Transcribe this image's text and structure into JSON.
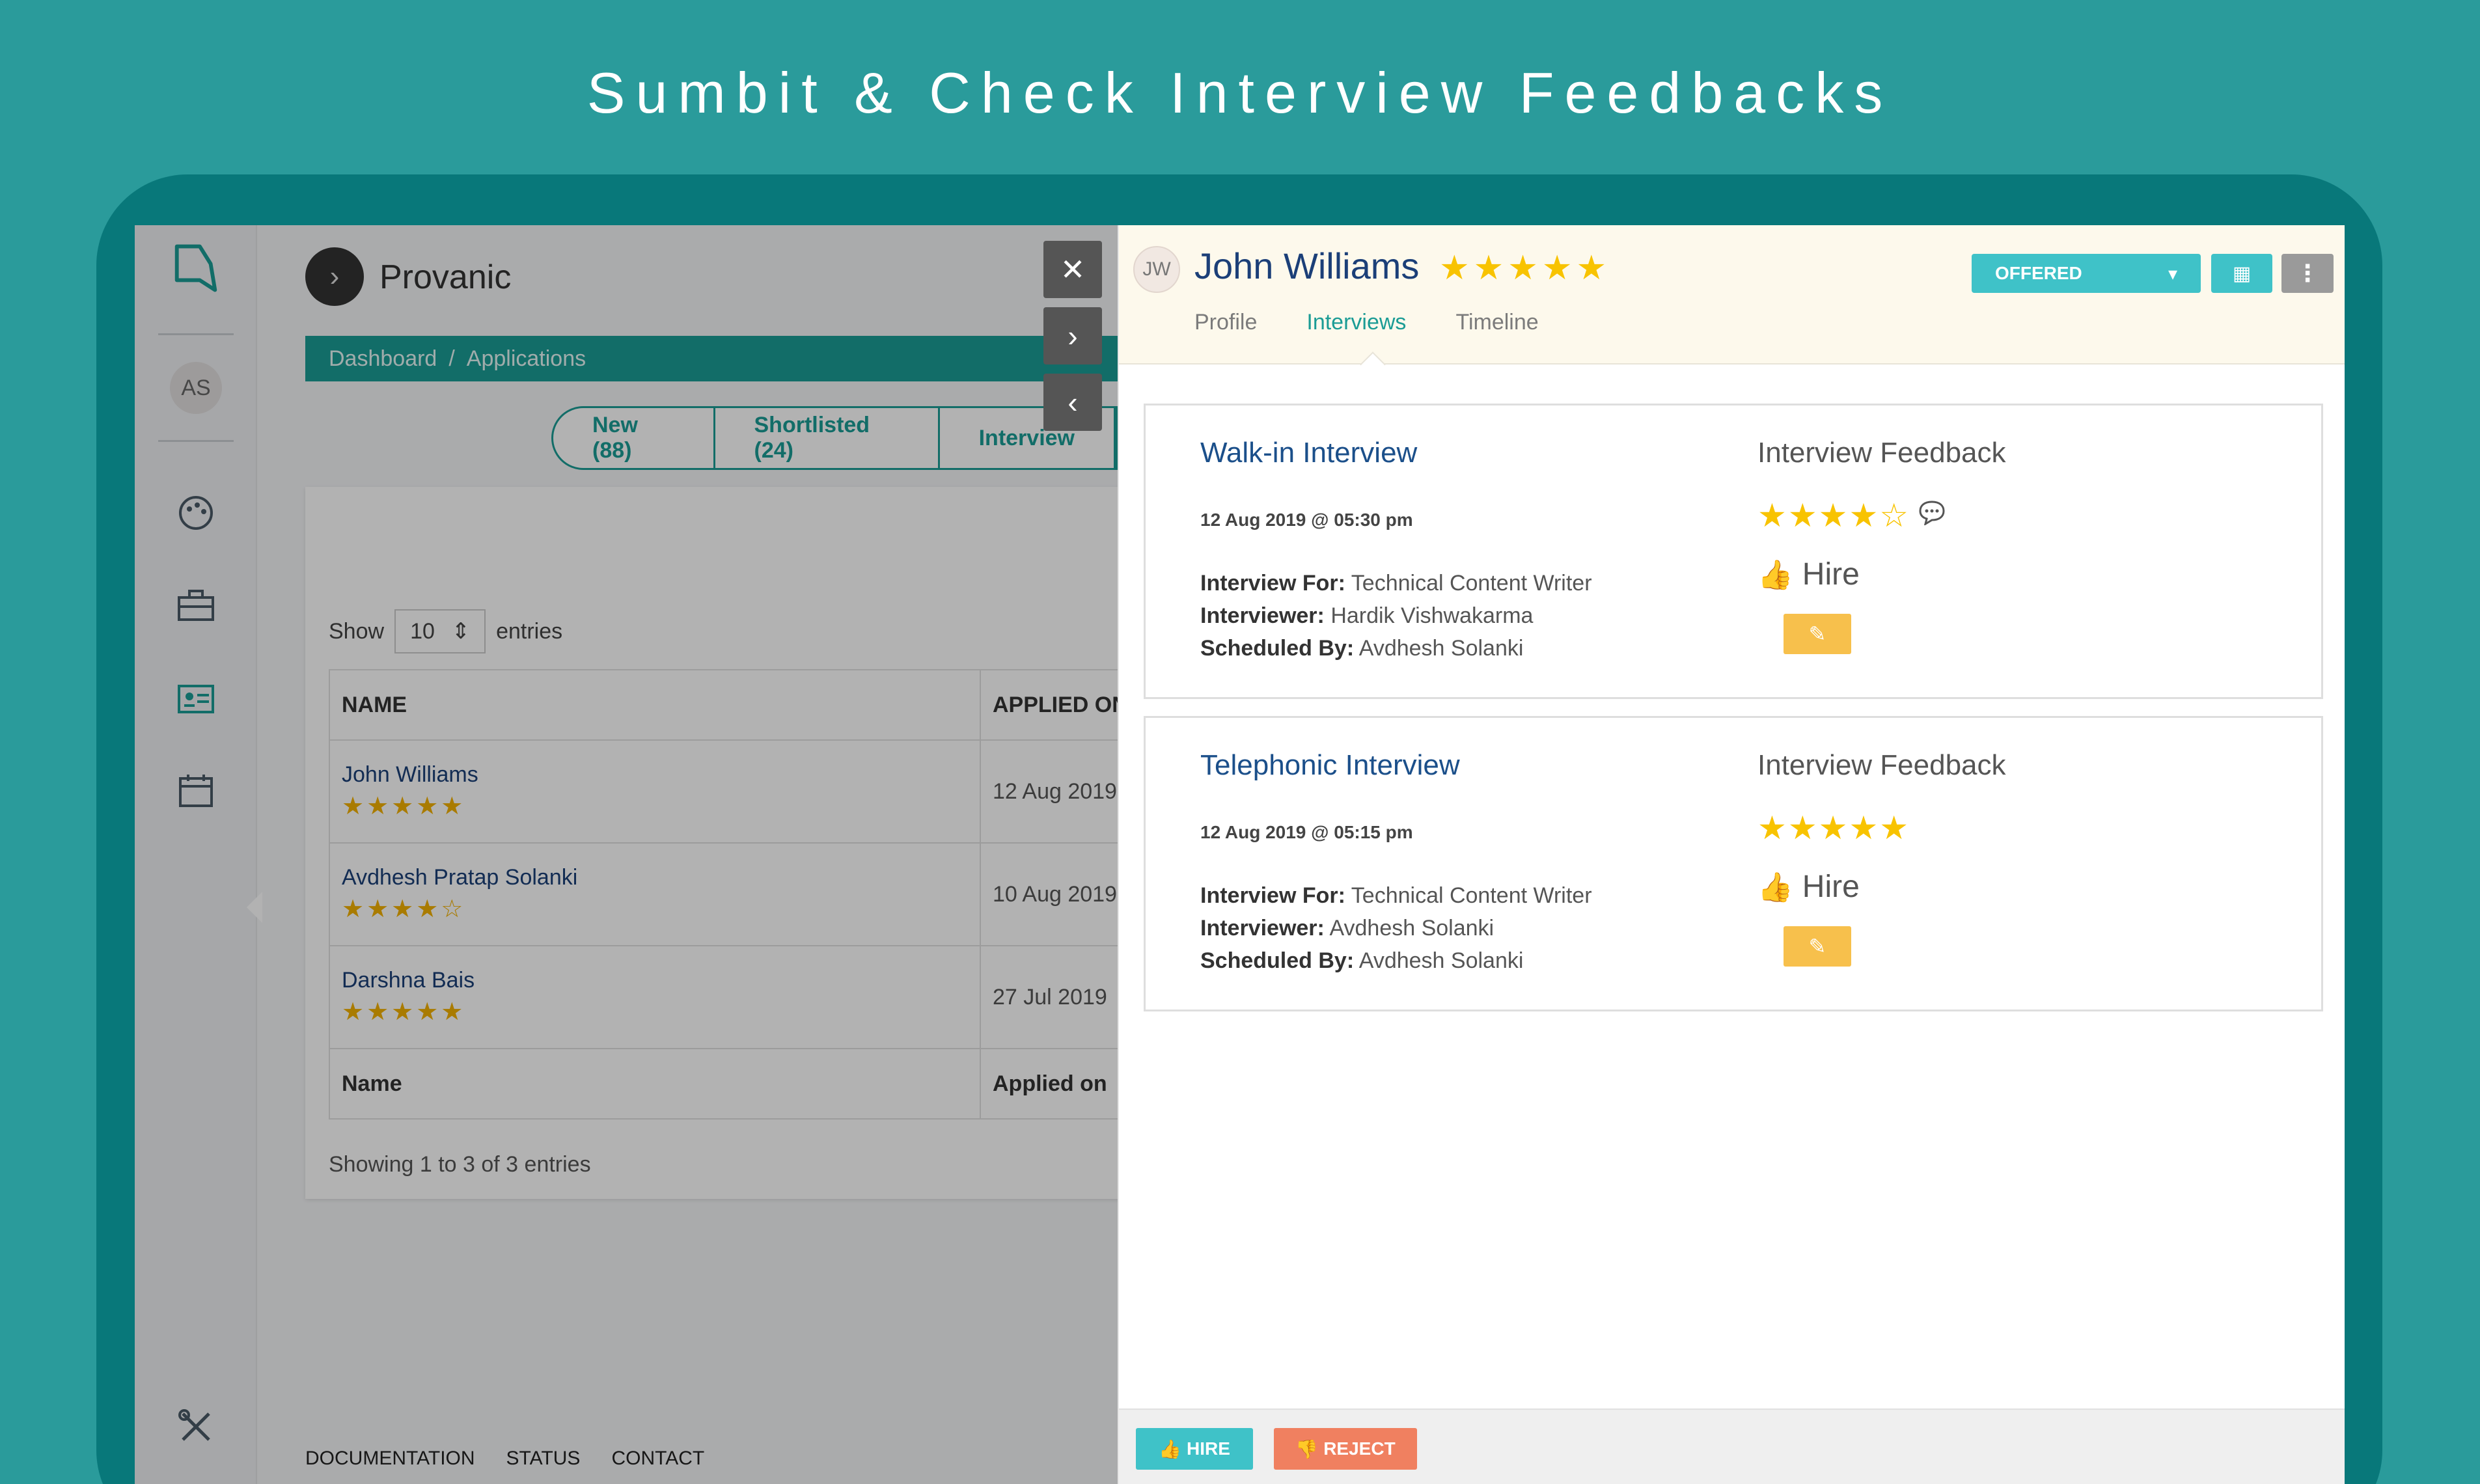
{
  "banner": {
    "title": "Sumbit & Check Interview Feedbacks"
  },
  "colors": {
    "background": "#2a9b9b",
    "tablet": "#08787a",
    "accent": "#1b9c95",
    "offered": "#3fc2c8",
    "reject": "#f08060",
    "edit": "#f7c04c",
    "star": "#f8c300"
  },
  "sidebar": {
    "avatar": "AS",
    "icons": [
      "logo-icon",
      "palette-icon",
      "briefcase-icon",
      "id-card-icon",
      "calendar-icon",
      "tools-icon"
    ]
  },
  "app": {
    "brand": "Provanic",
    "breadcrumb": [
      "Dashboard",
      "Applications"
    ],
    "breadcrumb_sep": "/",
    "tabs": [
      "New (88)",
      "Shortlisted (24)",
      "Interview"
    ],
    "show_label": "Show",
    "entries_value": "10",
    "entries_label": "entries",
    "table": {
      "headers": [
        "NAME",
        "APPLIED ON"
      ],
      "rows": [
        {
          "name": "John Williams",
          "date": "12 Aug 2019",
          "stars": "★★★★★"
        },
        {
          "name": "Avdhesh Pratap Solanki",
          "date": "10 Aug 2019",
          "stars": "★★★★☆"
        },
        {
          "name": "Darshna Bais",
          "date": "27 Jul 2019",
          "stars": "★★★★★"
        }
      ],
      "footers": [
        "Name",
        "Applied on"
      ]
    },
    "showing": "Showing 1 to 3 of 3 entries",
    "footer_links": [
      "DOCUMENTATION",
      "STATUS",
      "CONTACT"
    ]
  },
  "panel": {
    "initials": "JW",
    "name": "John Williams",
    "stars": "★★★★★",
    "status": "OFFERED",
    "tabs": [
      "Profile",
      "Interviews",
      "Timeline"
    ],
    "interviews": [
      {
        "title": "Walk-in Interview",
        "date": "12 Aug 2019 @ 05:30 pm",
        "for_label": "Interview For:",
        "for_value": "Technical Content Writer",
        "interviewer_label": "Interviewer:",
        "interviewer_value": "Hardik Vishwakarma",
        "scheduled_label": "Scheduled By:",
        "scheduled_value": "Avdhesh Solanki",
        "feedback_title": "Interview Feedback",
        "rating": "★★★★☆",
        "decision": "Hire"
      },
      {
        "title": "Telephonic Interview",
        "date": "12 Aug 2019 @ 05:15 pm",
        "for_label": "Interview For:",
        "for_value": "Technical Content Writer",
        "interviewer_label": "Interviewer:",
        "interviewer_value": "Avdhesh Solanki",
        "scheduled_label": "Scheduled By:",
        "scheduled_value": "Avdhesh Solanki",
        "feedback_title": "Interview Feedback",
        "rating": "★★★★★",
        "decision": "Hire"
      }
    ],
    "hire_label": "HIRE",
    "reject_label": "REJECT"
  }
}
